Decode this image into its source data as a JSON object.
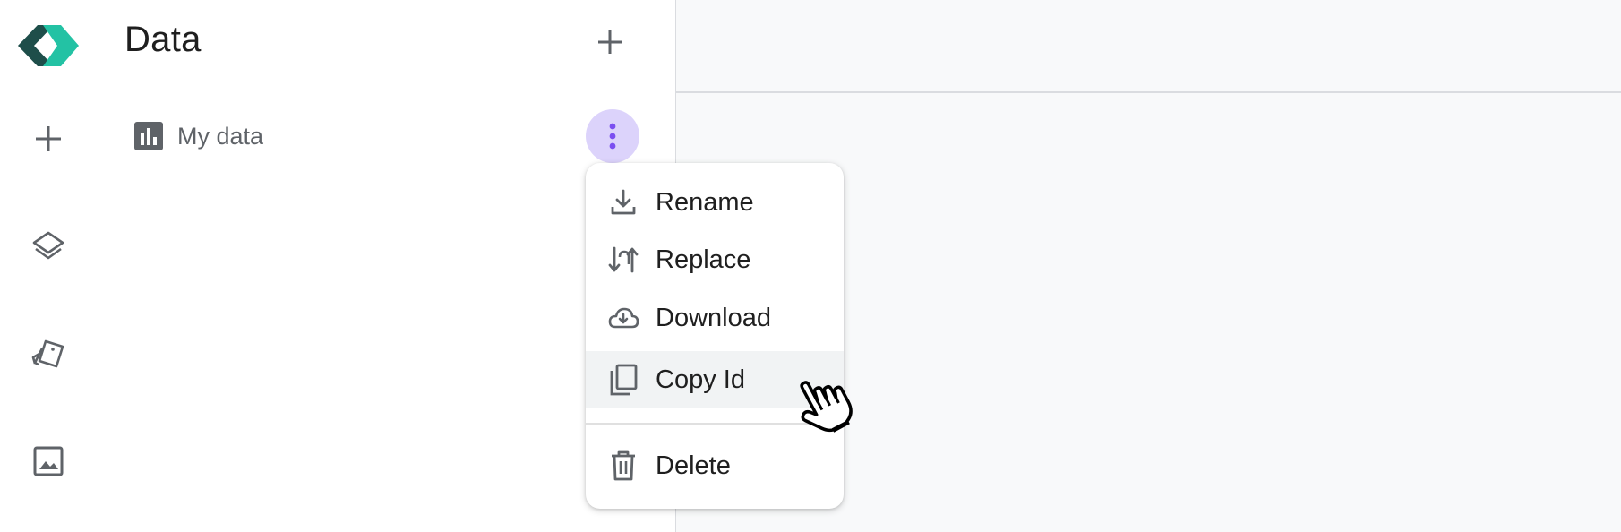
{
  "rail": {
    "logo_icon": "app-logo",
    "items": [
      {
        "icon": "plus-icon"
      },
      {
        "icon": "layers-icon"
      },
      {
        "icon": "cards-icon"
      },
      {
        "icon": "image-icon"
      }
    ]
  },
  "panel": {
    "title": "Data",
    "add_icon": "plus-icon",
    "items": [
      {
        "icon": "bar-chart-icon",
        "label": "My data"
      }
    ],
    "more_icon": "more-vert-icon"
  },
  "menu": {
    "items": [
      {
        "icon": "download-icon",
        "label": "Rename"
      },
      {
        "icon": "swap-vertical-icon",
        "label": "Replace"
      },
      {
        "icon": "cloud-download-icon",
        "label": "Download"
      },
      {
        "icon": "copy-icon",
        "label": "Copy Id",
        "highlighted": true
      },
      {
        "icon": "trash-icon",
        "label": "Delete"
      }
    ]
  },
  "colors": {
    "accent": "#7b4ff0",
    "accent_bg": "#dcd3fb",
    "logo_dark": "#1e4e4a",
    "logo_teal": "#23c2a4",
    "icon_gray": "#5f6368",
    "main_bg": "#f8f9fa"
  }
}
